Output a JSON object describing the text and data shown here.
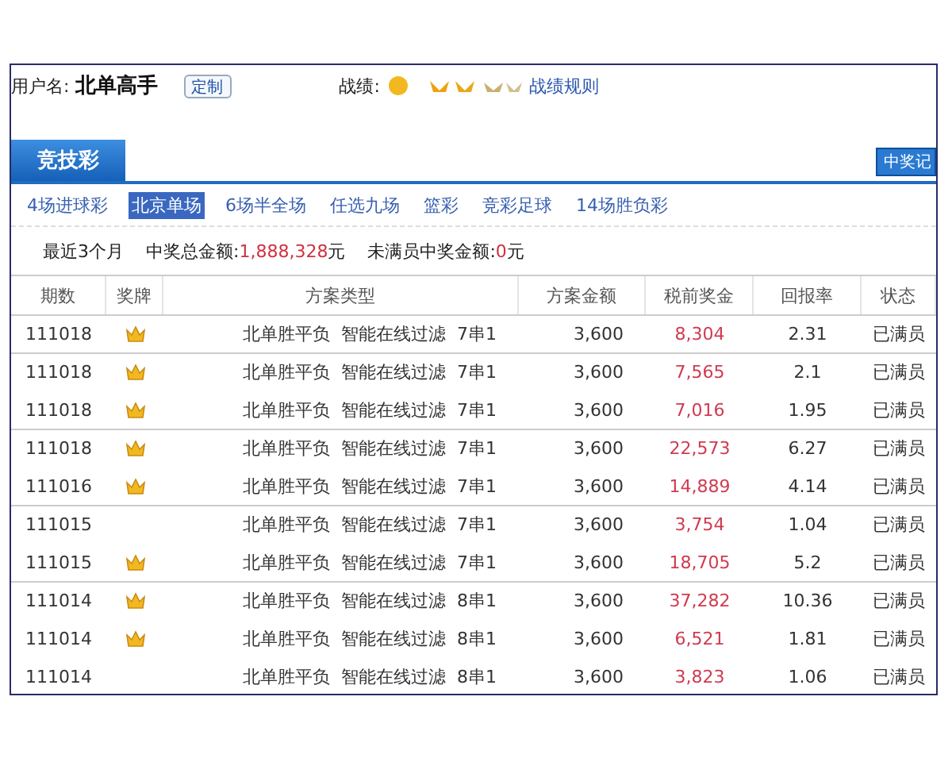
{
  "user": {
    "label": "用户名:",
    "name": "北单高手",
    "customize_button": "定制"
  },
  "record": {
    "label": "战绩:",
    "rules_link": "战绩规则"
  },
  "tabs": [
    {
      "label": "竞技彩",
      "selected": true
    }
  ],
  "side_button": "中奖记",
  "sub_nav": [
    {
      "label": "4场进球彩",
      "selected": false
    },
    {
      "label": "北京单场",
      "selected": true
    },
    {
      "label": "6场半全场",
      "selected": false
    },
    {
      "label": "任选九场",
      "selected": false
    },
    {
      "label": "篮彩",
      "selected": false
    },
    {
      "label": "竞彩足球",
      "selected": false
    },
    {
      "label": "14场胜负彩",
      "selected": false
    }
  ],
  "summary": {
    "period": "最近3个月",
    "total_label": "中奖总金额:",
    "total_value": "1,888,328",
    "total_unit": "元",
    "unfilled_label": "未满员中奖金额:",
    "unfilled_value": "0",
    "unfilled_unit": "元"
  },
  "table": {
    "columns": [
      "期数",
      "奖牌",
      "方案类型",
      "方案金额",
      "税前奖金",
      "回报率",
      "状态"
    ],
    "rows": [
      {
        "issue": "111018",
        "medal": true,
        "divider_above": false,
        "type": "北单胜平负  智能在线过滤  7串1",
        "amount": "3,600",
        "prize": "8,304",
        "rate": "2.31",
        "status": "已满员"
      },
      {
        "issue": "111018",
        "medal": true,
        "divider_above": true,
        "type": "北单胜平负  智能在线过滤  7串1",
        "amount": "3,600",
        "prize": "7,565",
        "rate": "2.1",
        "status": "已满员"
      },
      {
        "issue": "111018",
        "medal": true,
        "divider_above": false,
        "type": "北单胜平负  智能在线过滤  7串1",
        "amount": "3,600",
        "prize": "7,016",
        "rate": "1.95",
        "status": "已满员"
      },
      {
        "issue": "111018",
        "medal": true,
        "divider_above": true,
        "type": "北单胜平负  智能在线过滤  7串1",
        "amount": "3,600",
        "prize": "22,573",
        "rate": "6.27",
        "status": "已满员"
      },
      {
        "issue": "111016",
        "medal": true,
        "divider_above": false,
        "type": "北单胜平负  智能在线过滤  7串1",
        "amount": "3,600",
        "prize": "14,889",
        "rate": "4.14",
        "status": "已满员"
      },
      {
        "issue": "111015",
        "medal": false,
        "divider_above": true,
        "type": "北单胜平负  智能在线过滤  7串1",
        "amount": "3,600",
        "prize": "3,754",
        "rate": "1.04",
        "status": "已满员"
      },
      {
        "issue": "111015",
        "medal": true,
        "divider_above": false,
        "type": "北单胜平负  智能在线过滤  7串1",
        "amount": "3,600",
        "prize": "18,705",
        "rate": "5.2",
        "status": "已满员"
      },
      {
        "issue": "111014",
        "medal": true,
        "divider_above": true,
        "type": "北单胜平负  智能在线过滤  8串1",
        "amount": "3,600",
        "prize": "37,282",
        "rate": "10.36",
        "status": "已满员"
      },
      {
        "issue": "111014",
        "medal": true,
        "divider_above": false,
        "type": "北单胜平负  智能在线过滤  8串1",
        "amount": "3,600",
        "prize": "6,521",
        "rate": "1.81",
        "status": "已满员"
      },
      {
        "issue": "111014",
        "medal": false,
        "divider_above": false,
        "type": "北单胜平负  智能在线过滤  8串1",
        "amount": "3,600",
        "prize": "3,823",
        "rate": "1.06",
        "status": "已满员"
      }
    ]
  }
}
